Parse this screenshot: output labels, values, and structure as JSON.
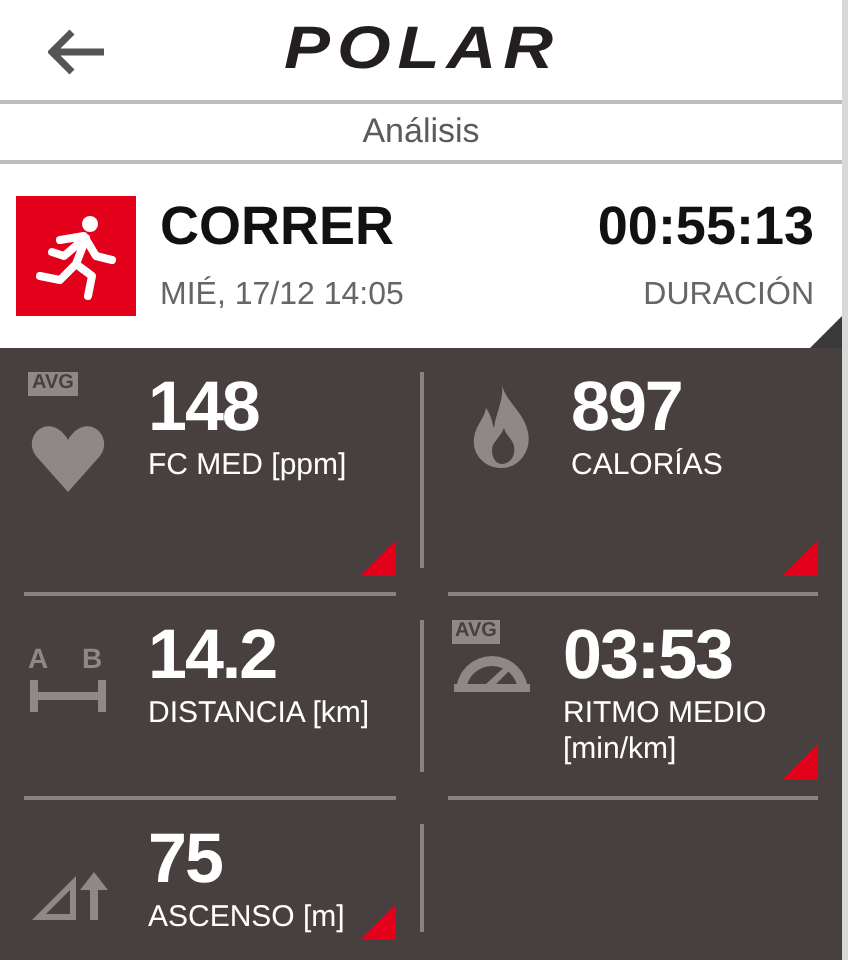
{
  "header": {
    "logo": "POLAR"
  },
  "subtitle": "Análisis",
  "activity": {
    "sport": "CORRER",
    "date": "MIÉ, 17/12 14:05",
    "value": "00:55:13",
    "label": "DURACIÓN"
  },
  "metrics": [
    {
      "kind": "heart",
      "badge": "AVG",
      "value": "148",
      "label": "FC MED [ppm]",
      "has_detail": true
    },
    {
      "kind": "flame",
      "value": "897",
      "label": "CALORÍAS",
      "has_detail": true
    },
    {
      "kind": "distance",
      "point_a": "A",
      "point_b": "B",
      "value": "14.2",
      "label": "DISTANCIA [km]",
      "has_detail": false
    },
    {
      "kind": "pace",
      "badge": "AVG",
      "value": "03:53",
      "label": "RITMO MEDIO [min/km]",
      "has_detail": true
    },
    {
      "kind": "ascent",
      "value": "75",
      "label": "ASCENSO [m]",
      "has_detail": true
    }
  ]
}
